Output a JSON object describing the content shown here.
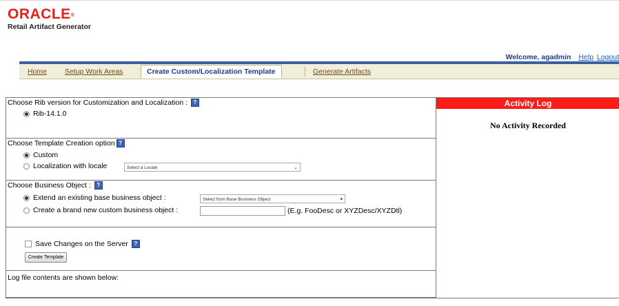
{
  "brand": {
    "logo_text": "ORACLE",
    "app_name": "Retail Artifact Generator"
  },
  "userbar": {
    "welcome": "Welcome, agadmin",
    "help": "Help",
    "logout": "Logout"
  },
  "tabs": [
    {
      "label": "Home"
    },
    {
      "label": "Setup Work Areas"
    },
    {
      "label": "Create Custom/Localization Template"
    },
    {
      "label": "Generate Artifacts"
    }
  ],
  "rib_section": {
    "label": "Choose Rib version for Customization and Localization :",
    "option": "Rib-14.1.0"
  },
  "template_section": {
    "label": "Choose Template Creation option",
    "custom": "Custom",
    "localization": "Localization with locale",
    "locale_placeholder": "Select a Locale"
  },
  "business_section": {
    "label": "Choose Business Object :",
    "extend": "Extend an existing base business object :",
    "base_placeholder": "Select from Base Business Object",
    "create_new": "Create a brand new custom business object :",
    "example_hint": "(E.g. FooDesc or XYZDesc/XYZDtl)",
    "custom_name_value": ""
  },
  "save_section": {
    "save_label": "Save Changes on the Server",
    "create_button": "Create Template"
  },
  "log_section": {
    "label": "Log file contents are shown below:"
  },
  "activity_log": {
    "title": "Activity Log",
    "empty_text": "No Activity Recorded"
  },
  "colors": {
    "brand_red": "#e2231a",
    "log_header_red": "#ff1a1a",
    "nav_blue": "#3b5fa0",
    "tab_bg": "#f1eedb"
  },
  "icons": {
    "help": "help-icon"
  }
}
